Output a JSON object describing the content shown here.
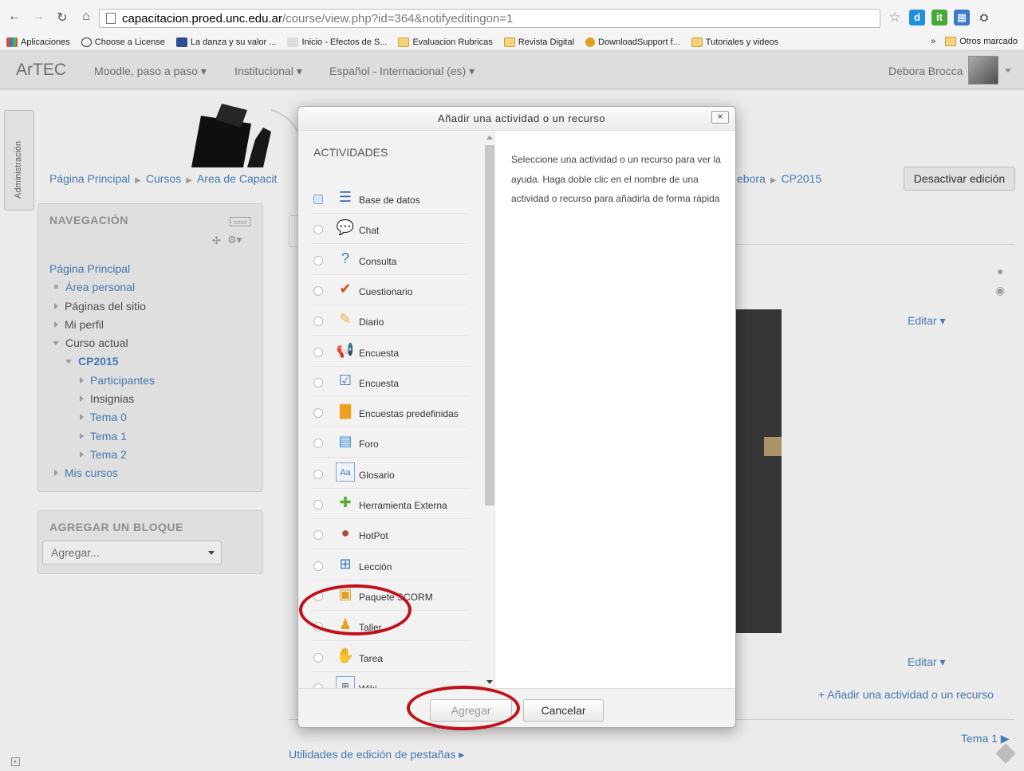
{
  "browser": {
    "url_domain": "capacitacion.proed.unc.edu.ar",
    "url_path": "/course/view.php?id=364&notifyeditingon=1",
    "nav_icons": [
      "back-icon",
      "forward-icon",
      "reload-icon",
      "home-icon"
    ],
    "bookmarks": [
      {
        "label": "Aplicaciones",
        "icon": "apps-icon"
      },
      {
        "label": "Choose a License",
        "icon": "cc-icon"
      },
      {
        "label": "La danza y su valor ...",
        "icon": "efd-icon"
      },
      {
        "label": "Inicio - Efectos de S...",
        "icon": "page-icon"
      },
      {
        "label": "Evaluacion Rubricas",
        "icon": "folder-icon"
      },
      {
        "label": "Revista Digital",
        "icon": "folder-icon"
      },
      {
        "label": "DownloadSupport f...",
        "icon": "download-icon"
      },
      {
        "label": "Tutoriales y videos",
        "icon": "folder-icon"
      }
    ],
    "bookmarks_overflow": "»",
    "other_bookmarks": "Otros marcado"
  },
  "navbar": {
    "brand": "ArTEC",
    "menus": [
      "Moodle, paso a paso ▾",
      "Institucional ▾",
      "Español - Internacional (es) ▾"
    ],
    "user": "Debora Brocca"
  },
  "page": {
    "admin_tab": "Administración",
    "breadcrumb": [
      "Página Principal",
      "Cursos",
      "Area de Capacit"
    ],
    "breadcrumb_right": [
      "ebora",
      "CP2015"
    ],
    "edit_toggle": "Desactivar edición",
    "navigation": {
      "title": "NAVEGACIÓN",
      "items": [
        {
          "label": "Página Principal"
        },
        {
          "label": "Área personal"
        },
        {
          "label": "Páginas del sitio"
        },
        {
          "label": "Mi perfil"
        },
        {
          "label": "Curso actual"
        },
        {
          "label": "CP2015"
        },
        {
          "label": "Participantes"
        },
        {
          "label": "Insignias"
        },
        {
          "label": "Tema 0"
        },
        {
          "label": "Tema 1"
        },
        {
          "label": "Tema 2"
        },
        {
          "label": "Mis cursos"
        }
      ]
    },
    "add_block": {
      "title": "AGREGAR UN BLOQUE",
      "select_value": "Agregar..."
    },
    "edit_link_1": "Editar ▾",
    "edit_link_2": "Editar ▾",
    "add_activity_link": "+ Añadir una actividad o un recurso",
    "next_topic": "Tema 1 ▶",
    "tab_utilities": "Utilidades de edición de pestañas ▸"
  },
  "modal": {
    "title": "Añadir una actividad o un recurso",
    "close": "×",
    "section_heading": "ACTIVIDADES",
    "activities": [
      {
        "label": "Base de datos",
        "icon": "database-icon",
        "color": "#3a68b4"
      },
      {
        "label": "Chat",
        "icon": "chat-icon",
        "color": "#f0a21a"
      },
      {
        "label": "Consulta",
        "icon": "question-icon",
        "color": "#3a7fd0"
      },
      {
        "label": "Cuestionario",
        "icon": "checkmark-icon",
        "color": "#d84a1b"
      },
      {
        "label": "Diario",
        "icon": "journal-icon",
        "color": "#e0b030"
      },
      {
        "label": "Encuesta",
        "icon": "megaphone-icon",
        "color": "#d8401c"
      },
      {
        "label": "Encuesta",
        "icon": "survey-icon",
        "color": "#4a78c0"
      },
      {
        "label": "Encuestas predefinidas",
        "icon": "bar-chart-icon",
        "color": "#f0a020"
      },
      {
        "label": "Foro",
        "icon": "forum-icon",
        "color": "#3a8fd8"
      },
      {
        "label": "Glosario",
        "icon": "glossary-icon",
        "color": "#3a78c0"
      },
      {
        "label": "Herramienta Externa",
        "icon": "puzzle-icon",
        "color": "#5aa830"
      },
      {
        "label": "HotPot",
        "icon": "hotpot-icon",
        "color": "#a0522d"
      },
      {
        "label": "Lección",
        "icon": "lesson-icon",
        "color": "#3a78c0"
      },
      {
        "label": "Paquete SCORM",
        "icon": "scorm-package-icon",
        "color": "#e0a020"
      },
      {
        "label": "Taller",
        "icon": "workshop-icon",
        "color": "#e8a020"
      },
      {
        "label": "Tarea",
        "icon": "assignment-icon",
        "color": "#c08040"
      },
      {
        "label": "Wiki",
        "icon": "wiki-icon",
        "color": "#444444"
      }
    ],
    "help_text": "Seleccione una actividad o un recurso para ver la ayuda. Haga doble clic en el nombre de una actividad o recurso para añadirla de forma rápida",
    "submit_label": "Agregar",
    "cancel_label": "Cancelar"
  }
}
